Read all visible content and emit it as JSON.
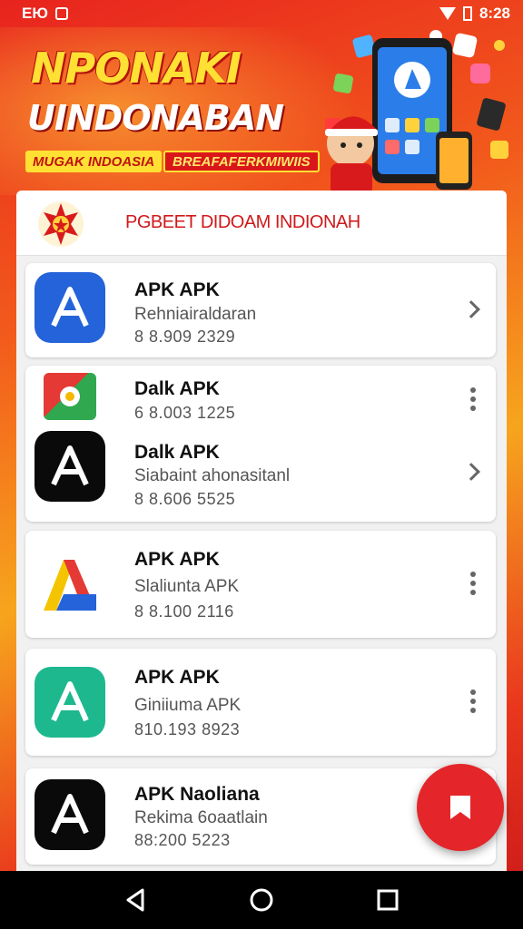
{
  "status_bar": {
    "left_text": "ЕЮ",
    "time": "8:28"
  },
  "banner": {
    "title_line1": "NPONAKI",
    "title_line2": "UINDONABAN",
    "tag1": "MUGAK INDOASIA",
    "tag2": "BREAFAFERKMIWIIS"
  },
  "panel": {
    "title": "PGBEET DIDOAM INDIONAH"
  },
  "apps": [
    {
      "name": "APK APK",
      "subtitle": "Rehniairaldaran",
      "meta": "8 8.909 2329",
      "action": "chevron",
      "icon": "blue-apk-icon",
      "color": "#2463d9"
    },
    {
      "name": "Dalk APK",
      "subtitle": "",
      "meta": "6 8.003 1225",
      "action": "kebab",
      "icon": "green-red-apk-icon",
      "color": "#2fa84f"
    },
    {
      "name": "Dalk APK",
      "subtitle": "Siabaint ahonasitanl",
      "meta": "8 8.606 5525",
      "action": "chevron",
      "icon": "black-apk-icon",
      "color": "#0a0a0a"
    },
    {
      "name": "APK APK",
      "subtitle": "Slaliunta APK",
      "meta": "8 8.100 2116",
      "action": "kebab",
      "icon": "tricolor-apk-icon",
      "color": "#e53935"
    },
    {
      "name": "APK APK",
      "subtitle": "Giniiuma APK",
      "meta": "810.193 8923",
      "action": "kebab",
      "icon": "teal-apk-icon",
      "color": "#1db88e"
    },
    {
      "name": "APK Naoliana",
      "subtitle": "Rekima 6oaatlain",
      "meta": "88:200 5223",
      "action": "none",
      "icon": "black-apk-icon",
      "color": "#0a0a0a"
    }
  ],
  "fab": {
    "icon": "bookmark-icon",
    "color": "#e4262a"
  },
  "nav": {
    "back": "back-icon",
    "home": "home-icon",
    "recents": "recents-icon"
  }
}
